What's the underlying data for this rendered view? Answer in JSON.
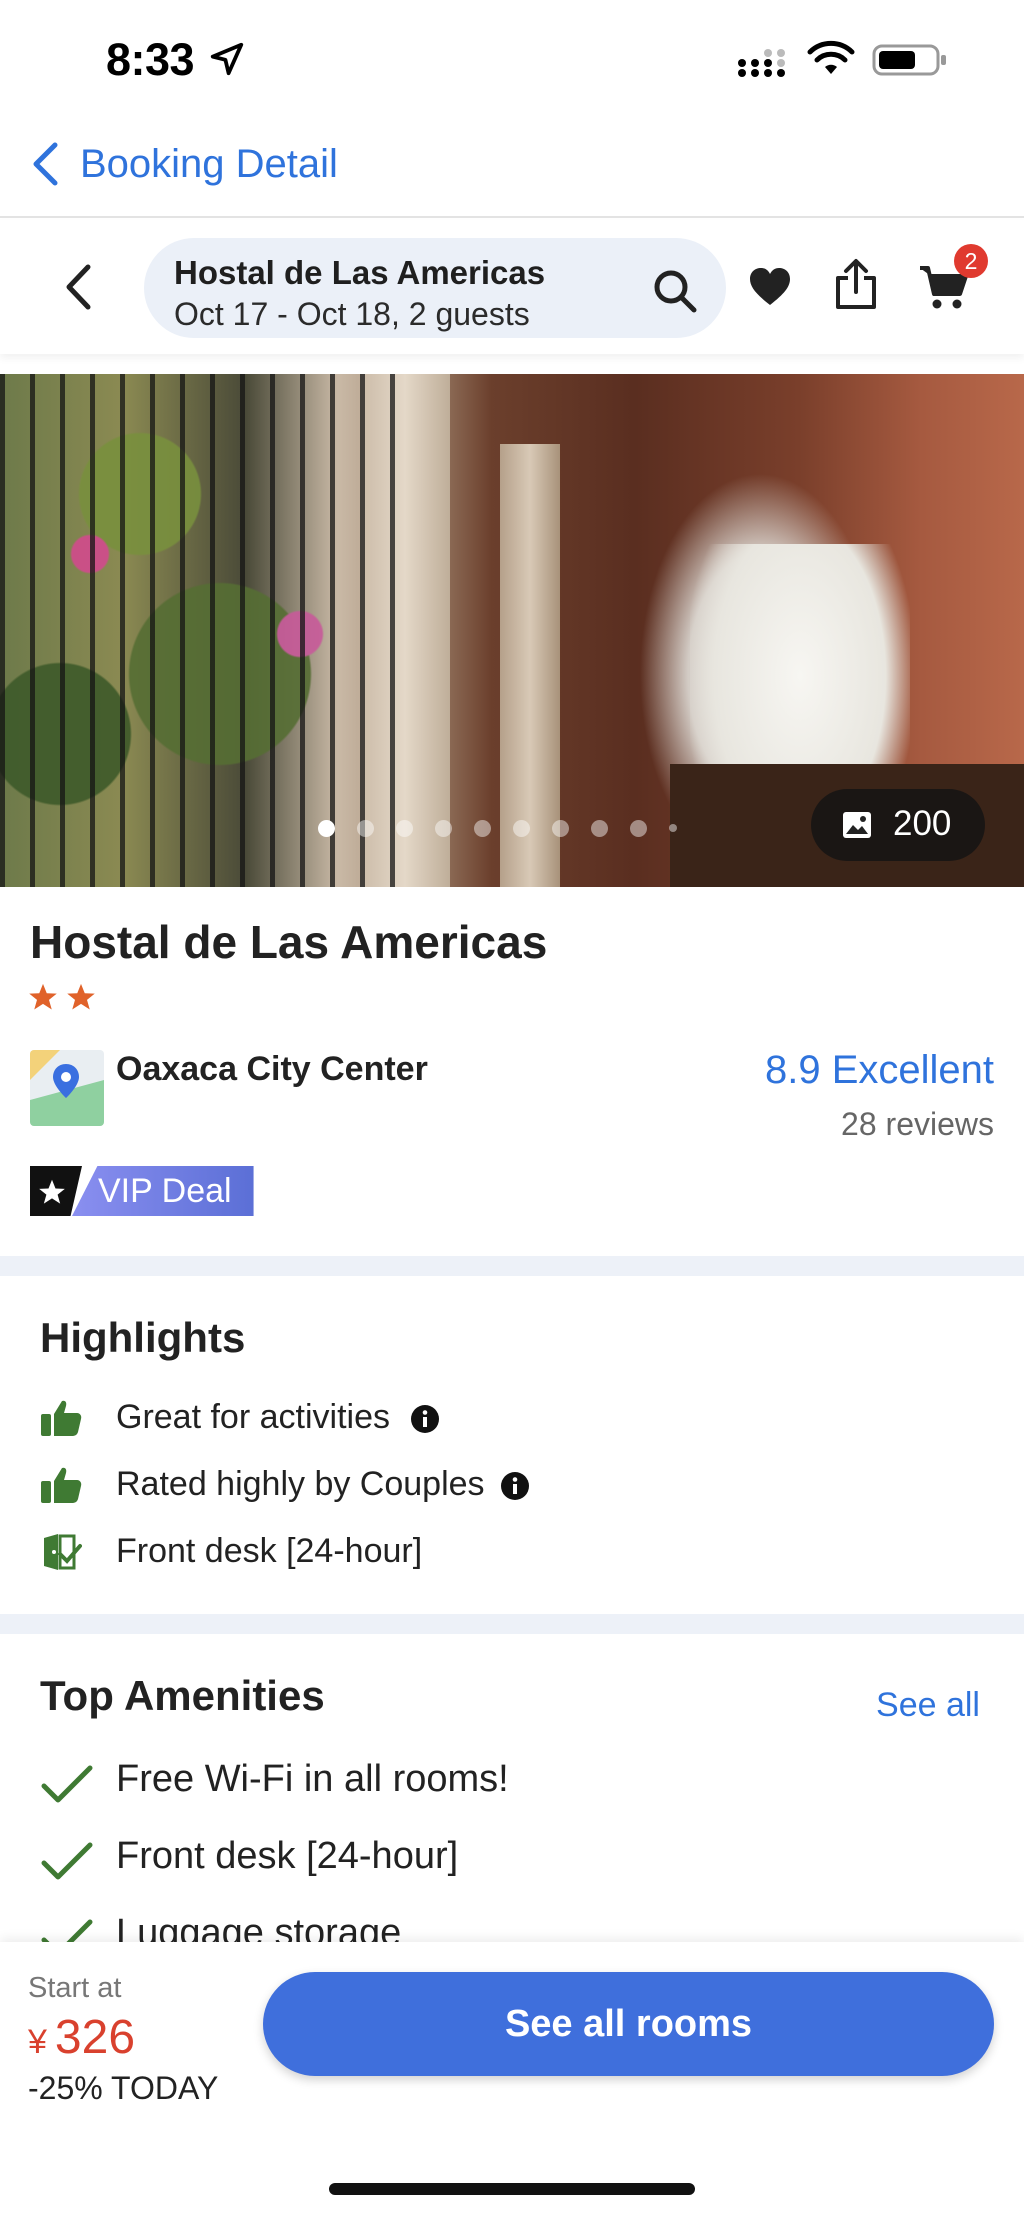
{
  "status_bar": {
    "time": "8:33"
  },
  "nav": {
    "back_label": "Booking Detail"
  },
  "search": {
    "hotel": "Hostal de Las Americas",
    "dates_guests": "Oct 17 - Oct 18, 2 guests",
    "cart_count": "2"
  },
  "gallery": {
    "photo_count": "200",
    "dot_count": 10,
    "active_index": 0
  },
  "hotel": {
    "name": "Hostal de Las Americas",
    "stars": 2,
    "location": "Oaxaca City Center",
    "rating": "8.9 Excellent",
    "reviews": "28 reviews",
    "vip_label": "VIP Deal"
  },
  "highlights": {
    "title": "Highlights",
    "items": [
      {
        "label": "Great for activities",
        "icon": "thumbs-up-icon"
      },
      {
        "label": "Rated highly by Couples",
        "icon": "thumbs-up-icon"
      },
      {
        "label": "Front desk [24-hour]",
        "icon": "front-desk-icon"
      }
    ]
  },
  "amenities": {
    "title": "Top Amenities",
    "see_all": "See all",
    "items": [
      {
        "label": "Free Wi-Fi in all rooms!"
      },
      {
        "label": "Front desk [24-hour]"
      },
      {
        "label": "Luggage storage"
      }
    ]
  },
  "footer": {
    "start_at": "Start at",
    "currency": "¥",
    "price": "326",
    "discount": "-25% TODAY",
    "cta": "See all rooms"
  },
  "colors": {
    "accent_blue": "#2f73dc",
    "button_blue": "#3f6fdc",
    "price_red": "#d9412e",
    "star_orange": "#e0622a",
    "highlight_green": "#3f7a33"
  }
}
